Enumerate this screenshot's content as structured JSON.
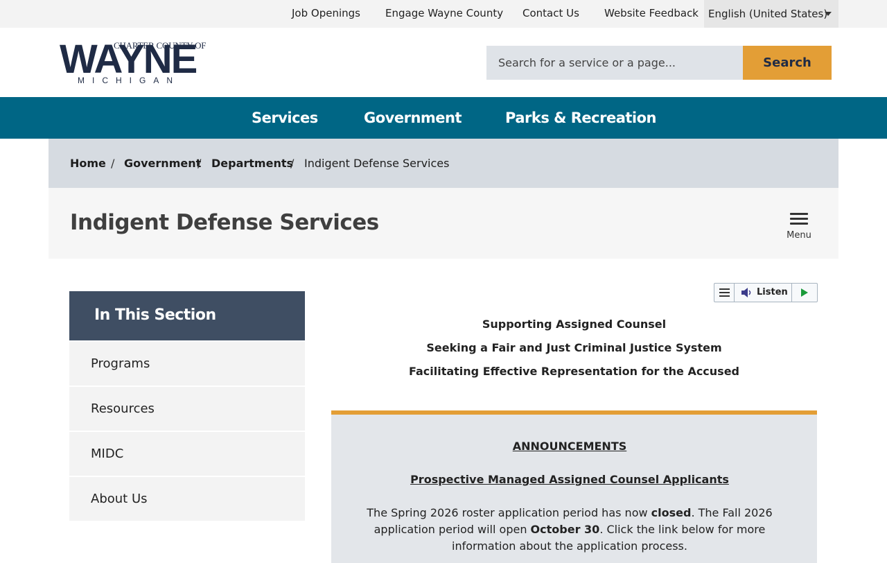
{
  "utility": {
    "links": [
      "Job Openings",
      "Engage Wayne County",
      "Contact Us",
      "Website Feedback"
    ],
    "language": "English (United States)"
  },
  "logo": {
    "top_line": "CHARTER COUNTY OF",
    "name": "WAYNE",
    "state": "MICHIGAN"
  },
  "search": {
    "placeholder": "Search for a service or a page...",
    "button": "Search"
  },
  "nav": {
    "items": [
      "Services",
      "Government",
      "Parks & Recreation"
    ]
  },
  "breadcrumb": {
    "items": [
      "Home",
      "Government",
      "Departments",
      "Indigent Defense Services"
    ],
    "separator": "/"
  },
  "page": {
    "title": "Indigent Defense Services",
    "menu_label": "Menu"
  },
  "sidebar": {
    "heading": "In This Section",
    "items": [
      "Programs",
      "Resources",
      "MIDC",
      "About Us"
    ]
  },
  "listen": {
    "label": "Listen"
  },
  "taglines": [
    "Supporting Assigned Counsel",
    "Seeking a Fair and Just Criminal Justice System",
    "Facilitating Effective Representation for the Accused"
  ],
  "announcements": {
    "title": "ANNOUNCEMENTS",
    "link": "Prospective Managed Assigned Counsel Applicants",
    "body_1": "The Spring 2026 roster application period has now ",
    "body_bold_1": "closed",
    "body_2": ". The Fall 2026 application period will open ",
    "body_bold_2": "October 30",
    "body_3": ". Click the link below for more information about the application process."
  },
  "colors": {
    "nav": "#006685",
    "accent": "#e39e36",
    "sidebar_head": "#3f4e63",
    "logo": "#1f2b45"
  }
}
